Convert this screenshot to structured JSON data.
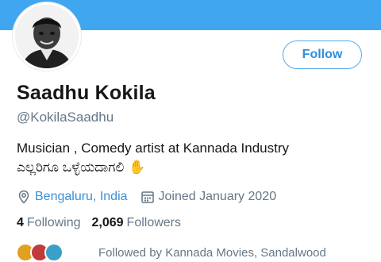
{
  "profile": {
    "name": "Saadhu Kokila",
    "handle": "@KokilaSaadhu",
    "bio_line1": "Musician , Comedy artist at Kannada Industry",
    "bio_line2": "ಎಲ್ಲರಿಗೂ ಒಳ್ಳೆಯದಾಗಲಿ",
    "bio_emoji": "✋",
    "location": "Bengaluru, India",
    "joined": "Joined January 2020"
  },
  "actions": {
    "follow_label": "Follow"
  },
  "stats": {
    "following_count": "4",
    "following_label": "Following",
    "followers_count": "2,069",
    "followers_label": "Followers"
  },
  "followed_by": {
    "text": "Followed by Kannada Movies, Sandalwood"
  },
  "icons": {
    "location": "location-pin-icon",
    "calendar": "calendar-icon",
    "hand": "raised-hand-emoji"
  },
  "colors": {
    "banner": "#41a6f0",
    "accent": "#2d8fdc",
    "text_primary": "#14171a",
    "text_secondary": "#657786"
  }
}
